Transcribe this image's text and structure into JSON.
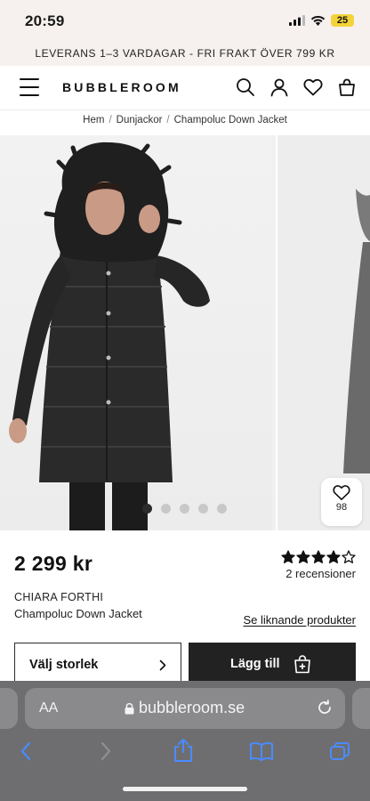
{
  "status_bar": {
    "time": "20:59",
    "battery": "25"
  },
  "promo": {
    "text": "LEVERANS 1–3 VARDAGAR - FRI FRAKT ÖVER 799 KR"
  },
  "header": {
    "logo": "BUBBLEROOM",
    "icons": [
      "menu-icon",
      "search-icon",
      "account-icon",
      "heart-icon",
      "bag-icon"
    ]
  },
  "breadcrumb": {
    "items": [
      "Hem",
      "Dunjackor",
      "Champoluc Down Jacket"
    ],
    "separator": "/"
  },
  "gallery": {
    "image_count": 5,
    "active_index": 0,
    "wishlist_count": "98"
  },
  "product": {
    "price": "2 299 kr",
    "rating": 4,
    "max_rating": 5,
    "reviews": "2 recensioner",
    "brand": "CHIARA FORTHI",
    "name": "Champoluc Down Jacket",
    "similar_link": "Se liknande produkter",
    "size_select": "Välj storlek",
    "add_to_cart": "Lägg till"
  },
  "browser": {
    "aa_label": "AA",
    "url": "bubbleroom.se"
  },
  "colors": {
    "accent": "#222222",
    "promo_bg": "#f6f1ee",
    "browser_bg": "#6e6e70",
    "battery": "#f3d33a"
  }
}
